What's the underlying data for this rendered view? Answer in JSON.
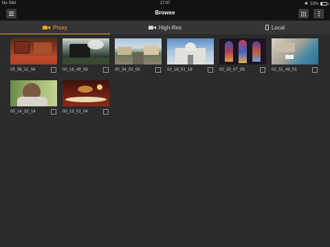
{
  "status_bar": {
    "carrier": "No SIM",
    "time": "17:07",
    "battery": "22%"
  },
  "nav": {
    "title": "Browse"
  },
  "tabs": [
    {
      "label": "Proxy",
      "active": true,
      "icon": "camera-icon"
    },
    {
      "label": "High-Res",
      "active": false,
      "icon": "camera-icon"
    },
    {
      "label": "Local",
      "active": false,
      "icon": "tablet-icon"
    }
  ],
  "clips": [
    {
      "name": "05_36_11_04"
    },
    {
      "name": "00_18_49_08"
    },
    {
      "name": "00_34_02_00"
    },
    {
      "name": "02_18_51_18"
    },
    {
      "name": "02_20_07_09"
    },
    {
      "name": "02_31_49_01"
    },
    {
      "name": "00_14_32_14"
    },
    {
      "name": "00_15_01_04"
    }
  ],
  "colors": {
    "accent": "#f0a830",
    "background": "#2b2b2b",
    "bar": "#121212"
  }
}
